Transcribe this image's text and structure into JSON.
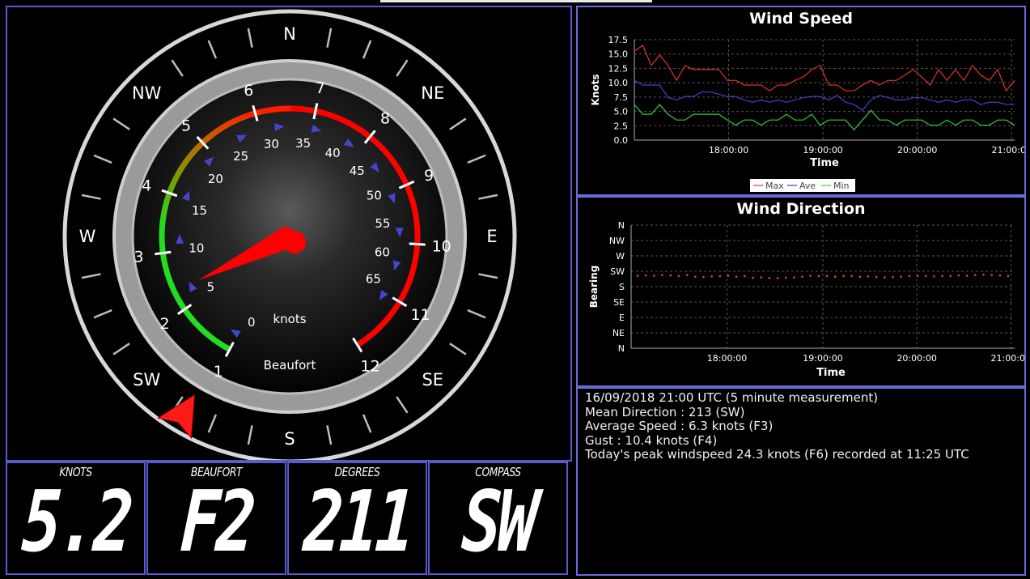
{
  "gauge": {
    "compass_points": [
      {
        "label": "N",
        "deg": 0
      },
      {
        "label": "NE",
        "deg": 45
      },
      {
        "label": "E",
        "deg": 90
      },
      {
        "label": "SE",
        "deg": 135
      },
      {
        "label": "S",
        "deg": 180
      },
      {
        "label": "SW",
        "deg": 225
      },
      {
        "label": "W",
        "deg": 270
      },
      {
        "label": "NW",
        "deg": 315
      }
    ],
    "beaufort_labels": [
      "1",
      "2",
      "3",
      "4",
      "5",
      "6",
      "7",
      "8",
      "9",
      "10",
      "11",
      "12"
    ],
    "knot_labels": [
      "0",
      "5",
      "10",
      "15",
      "20",
      "25",
      "30",
      "35",
      "40",
      "45",
      "50",
      "55",
      "60",
      "65"
    ],
    "units_label": "knots",
    "scale_label": "Beaufort",
    "speed_knots": 5.2,
    "direction_deg": 211,
    "colors": {
      "low": "#22dd22",
      "mid": "#c8a000",
      "high": "#ff0000",
      "needle": "#ff0000",
      "marker": "#4444cc"
    }
  },
  "readouts": [
    {
      "label": "KNOTS",
      "value": "5.2"
    },
    {
      "label": "BEAUFORT",
      "value": "F2"
    },
    {
      "label": "DEGREES",
      "value": "211"
    },
    {
      "label": "COMPASS",
      "value": "SW"
    }
  ],
  "speed_chart": {
    "title": "Wind Speed",
    "ylabel": "Knots",
    "xlabel": "Time",
    "yticks": [
      "0.0",
      "2.5",
      "5.0",
      "7.5",
      "10.0",
      "12.5",
      "15.0",
      "17.5"
    ],
    "ylim": [
      0,
      17.5
    ],
    "xticks": [
      "18:00:00",
      "19:00:00",
      "20:00:00",
      "21:00:00"
    ],
    "legend": [
      "Max",
      "Ave",
      "Min"
    ],
    "series_colors": [
      "#e03030",
      "#4040d0",
      "#30d030"
    ],
    "max": [
      15.5,
      16.5,
      13,
      14.8,
      13,
      10.4,
      13,
      12.3,
      12.3,
      12.3,
      12.3,
      10.4,
      10.4,
      9.6,
      9.6,
      9.6,
      8.6,
      9.6,
      9.6,
      10.4,
      11,
      12.3,
      13,
      9.6,
      9.6,
      8.6,
      8.6,
      9.6,
      10.4,
      9.6,
      10.4,
      10.4,
      11.3,
      12.3,
      11,
      9.6,
      12.3,
      10.4,
      12.3,
      10.4,
      13,
      11.3,
      10.4,
      12.3,
      8.6,
      10.4
    ],
    "ave": [
      10.4,
      9.6,
      9.6,
      9.6,
      7.4,
      7,
      7.6,
      7.6,
      8.4,
      8.4,
      8,
      7.6,
      7.6,
      7,
      6.6,
      7,
      6.6,
      7,
      6.6,
      7,
      7.4,
      7.6,
      7.6,
      7,
      7.8,
      6.6,
      6.2,
      5.2,
      7,
      7.8,
      7.4,
      7,
      7,
      7.4,
      7.4,
      7,
      6.6,
      7,
      6.6,
      7,
      7,
      6.2,
      6.6,
      6.6,
      6.2,
      6.2
    ],
    "min": [
      6.2,
      4.5,
      4.5,
      6.2,
      4.5,
      3.5,
      3.5,
      4.5,
      4.5,
      4.5,
      4.5,
      3.5,
      2.6,
      3.5,
      3.5,
      2.6,
      3.5,
      3.5,
      4.5,
      3.5,
      3.5,
      4.5,
      2.6,
      3.5,
      3.5,
      3.5,
      1.8,
      3.5,
      5.2,
      3.5,
      3.5,
      2.6,
      3.5,
      3.5,
      3.5,
      2.6,
      2.6,
      3.5,
      2.6,
      3.5,
      3.5,
      2.6,
      2.6,
      3.5,
      3.5,
      2.6
    ]
  },
  "dir_chart": {
    "title": "Wind Direction",
    "ylabel": "Bearing",
    "xlabel": "Time",
    "yticks": [
      "N",
      "NE",
      "E",
      "SE",
      "S",
      "SW",
      "W",
      "NW",
      "N"
    ],
    "xticks": [
      "18:00:00",
      "19:00:00",
      "20:00:00",
      "21:00:00"
    ],
    "point_color": "#e04040",
    "bearings": [
      212,
      213,
      212,
      214,
      213,
      211,
      214,
      209,
      208,
      210,
      211,
      212,
      209,
      211,
      206,
      207,
      205,
      205,
      206,
      207,
      209,
      212,
      211,
      211,
      209,
      211,
      211,
      209,
      210,
      208,
      207,
      208,
      209,
      211,
      211,
      211,
      210,
      211,
      211,
      213,
      212,
      214,
      215,
      214,
      213,
      211
    ]
  },
  "info": {
    "lines": [
      "16/09/2018 21:00 UTC (5 minute measurement)",
      "Mean Direction : 213 (SW)",
      "Average Speed : 6.3 knots (F3)",
      "Gust : 10.4 knots (F4)",
      "Today's peak windspeed 24.3 knots (F6) recorded at 11:25 UTC"
    ]
  }
}
